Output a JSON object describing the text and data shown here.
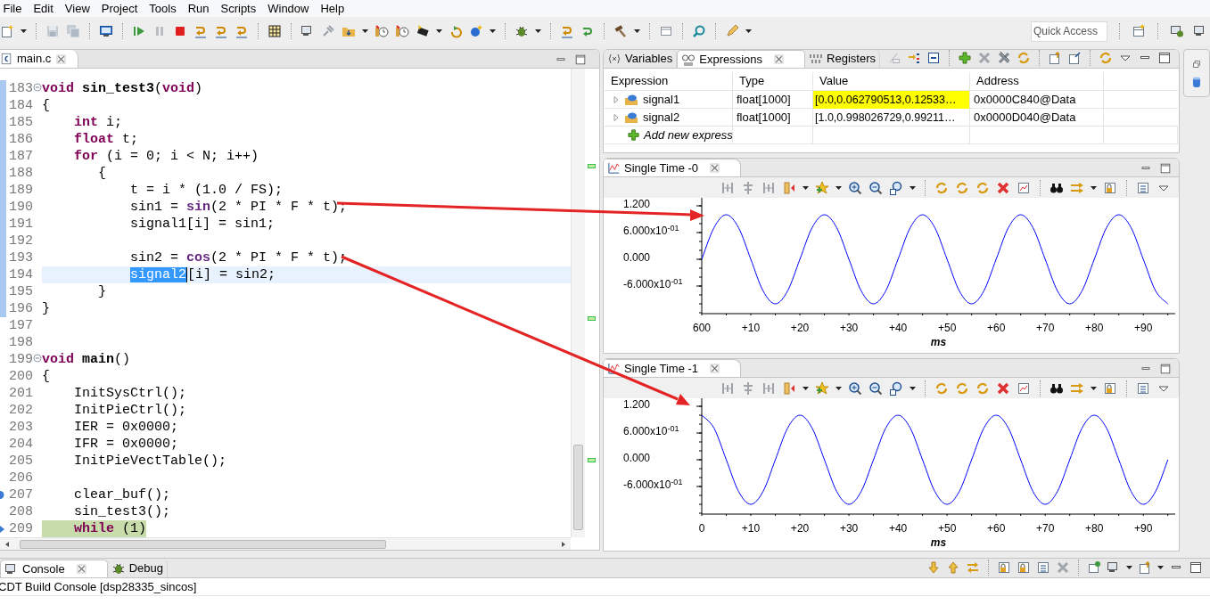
{
  "menu": [
    "File",
    "Edit",
    "View",
    "Project",
    "Tools",
    "Run",
    "Scripts",
    "Window",
    "Help"
  ],
  "quick_access": {
    "placeholder": "Quick Access"
  },
  "editor": {
    "tab": {
      "label": "main.c",
      "selected": true
    },
    "lines": [
      {
        "number": "183",
        "fold": true,
        "scope": true,
        "current": false,
        "executing": false,
        "breakpoint": false,
        "tokens": [
          {
            "text": "void",
            "kind": "keyword"
          },
          {
            "text": " sin_test3",
            "kind": "function"
          },
          {
            "text": "("
          },
          {
            "text": "void",
            "kind": "keyword"
          },
          {
            "text": ")"
          }
        ]
      },
      {
        "number": "184",
        "fold": false,
        "scope": true,
        "current": false,
        "executing": false,
        "breakpoint": false,
        "tokens": [
          {
            "text": "{"
          }
        ]
      },
      {
        "number": "185",
        "fold": false,
        "scope": true,
        "current": false,
        "executing": false,
        "breakpoint": false,
        "tokens": [
          {
            "text": "    int",
            "kind": "keyword"
          },
          {
            "text": " i;"
          }
        ]
      },
      {
        "number": "186",
        "fold": false,
        "scope": true,
        "current": false,
        "executing": false,
        "breakpoint": false,
        "tokens": [
          {
            "text": "    float",
            "kind": "keyword"
          },
          {
            "text": " t;"
          }
        ]
      },
      {
        "number": "187",
        "fold": false,
        "scope": true,
        "current": false,
        "executing": false,
        "breakpoint": false,
        "tokens": [
          {
            "text": "    for",
            "kind": "keyword"
          },
          {
            "text": " (i = 0; i < N; i++)"
          }
        ]
      },
      {
        "number": "188",
        "fold": false,
        "scope": true,
        "current": false,
        "executing": false,
        "breakpoint": false,
        "tokens": [
          {
            "text": "       {"
          }
        ]
      },
      {
        "number": "189",
        "fold": false,
        "scope": true,
        "current": false,
        "executing": false,
        "breakpoint": false,
        "tokens": [
          {
            "text": "           t = i * (1.0 / FS);"
          }
        ]
      },
      {
        "number": "190",
        "fold": false,
        "scope": true,
        "current": false,
        "executing": false,
        "breakpoint": false,
        "tokens": [
          {
            "text": "           sin1 = "
          },
          {
            "text": "sin",
            "kind": "builtin"
          },
          {
            "text": "(2 * PI * F * t);"
          }
        ]
      },
      {
        "number": "191",
        "fold": false,
        "scope": true,
        "current": false,
        "executing": false,
        "breakpoint": false,
        "tokens": [
          {
            "text": "           signal1[i] = sin1;"
          }
        ]
      },
      {
        "number": "192",
        "fold": false,
        "scope": true,
        "current": false,
        "executing": false,
        "breakpoint": false
      },
      {
        "number": "193",
        "fold": false,
        "scope": true,
        "current": false,
        "executing": false,
        "breakpoint": false,
        "tokens": [
          {
            "text": "           sin2 = "
          },
          {
            "text": "cos",
            "kind": "builtin"
          },
          {
            "text": "(2 * PI * F * t);"
          }
        ]
      },
      {
        "number": "194",
        "fold": false,
        "scope": true,
        "current": true,
        "executing": false,
        "breakpoint": false,
        "tokens": [
          {
            "text": "           signal2",
            "kind": "selection"
          },
          {
            "text": "[i] = sin2;"
          }
        ]
      },
      {
        "number": "195",
        "fold": false,
        "scope": true,
        "current": false,
        "executing": false,
        "breakpoint": false,
        "tokens": [
          {
            "text": "       }"
          }
        ]
      },
      {
        "number": "196",
        "fold": false,
        "scope": true,
        "current": false,
        "executing": false,
        "breakpoint": false,
        "tokens": [
          {
            "text": "}"
          }
        ]
      },
      {
        "number": "197",
        "fold": false,
        "scope": false,
        "current": false,
        "executing": false,
        "breakpoint": false
      },
      {
        "number": "198",
        "fold": false,
        "scope": false,
        "current": false,
        "executing": false,
        "breakpoint": false
      },
      {
        "number": "199",
        "fold": true,
        "scope": false,
        "current": false,
        "executing": false,
        "breakpoint": false,
        "tokens": [
          {
            "text": "void",
            "kind": "keyword"
          },
          {
            "text": " main",
            "kind": "function"
          },
          {
            "text": "()"
          }
        ]
      },
      {
        "number": "200",
        "fold": false,
        "scope": false,
        "current": false,
        "executing": false,
        "breakpoint": false,
        "tokens": [
          {
            "text": "{"
          }
        ]
      },
      {
        "number": "201",
        "fold": false,
        "scope": false,
        "current": false,
        "executing": false,
        "breakpoint": false,
        "tokens": [
          {
            "text": "    InitSysCtrl();"
          }
        ]
      },
      {
        "number": "202",
        "fold": false,
        "scope": false,
        "current": false,
        "executing": false,
        "breakpoint": false,
        "tokens": [
          {
            "text": "    InitPieCtrl();"
          }
        ]
      },
      {
        "number": "203",
        "fold": false,
        "scope": false,
        "current": false,
        "executing": false,
        "breakpoint": false,
        "tokens": [
          {
            "text": "    IER = 0x0000;"
          }
        ]
      },
      {
        "number": "204",
        "fold": false,
        "scope": false,
        "current": false,
        "executing": false,
        "breakpoint": false,
        "tokens": [
          {
            "text": "    IFR = 0x0000;"
          }
        ]
      },
      {
        "number": "205",
        "fold": false,
        "scope": false,
        "current": false,
        "executing": false,
        "breakpoint": false,
        "tokens": [
          {
            "text": "    InitPieVectTable();"
          }
        ]
      },
      {
        "number": "206",
        "fold": false,
        "scope": false,
        "current": false,
        "executing": false,
        "breakpoint": false
      },
      {
        "number": "207",
        "fold": false,
        "scope": false,
        "current": false,
        "executing": false,
        "breakpoint": true,
        "tokens": [
          {
            "text": "    clear_buf();"
          }
        ]
      },
      {
        "number": "208",
        "fold": false,
        "scope": false,
        "current": false,
        "executing": false,
        "breakpoint": false,
        "tokens": [
          {
            "text": "    sin_test3();"
          }
        ]
      },
      {
        "number": "209",
        "fold": false,
        "scope": false,
        "current": false,
        "executing": true,
        "breakpoint": false,
        "tokens": [
          {
            "text": "    while",
            "kind": "keyword"
          },
          {
            "text": " (1)"
          }
        ]
      }
    ]
  },
  "expressions": {
    "tabs": [
      {
        "label": "Variables",
        "kind": "variables",
        "selected": false
      },
      {
        "label": "Expressions",
        "kind": "expressions",
        "selected": true
      },
      {
        "label": "Registers",
        "kind": "registers",
        "selected": false
      }
    ],
    "columns": [
      "Expression",
      "Type",
      "Value",
      "Address"
    ],
    "rows": [
      {
        "expression": "signal1",
        "type": "float[1000]",
        "value": "[0.0,0.062790513,0.12533…",
        "address": "0x0000C840@Data",
        "expanded": false,
        "changed": true
      },
      {
        "expression": "signal2",
        "type": "float[1000]",
        "value": "[1.0,0.998026729,0.99211…",
        "address": "0x0000D040@Data",
        "expanded": false,
        "changed": false
      }
    ],
    "add_row": "Add new express"
  },
  "graphs": [
    {
      "tab": "Single Time -0",
      "chart_data": {
        "type": "line",
        "xlabel": "ms",
        "categories": [
          "600",
          null,
          null,
          null,
          "+10",
          null,
          null,
          null,
          "+20",
          null,
          null,
          null,
          "+30",
          null,
          null,
          null,
          "+40",
          null,
          null,
          null,
          "+50",
          null,
          null,
          null,
          "+60",
          null,
          null,
          null,
          "+70",
          null,
          null,
          null,
          "+80",
          null,
          null,
          null,
          "+90",
          null,
          null
        ],
        "series": [
          {
            "color": "#0000ff",
            "values": [
              0,
              0.71,
              1,
              0.71,
              0,
              -0.71,
              -1,
              -0.71,
              0,
              0.71,
              1,
              0.71,
              0,
              -0.71,
              -1,
              -0.71,
              0,
              0.71,
              1,
              0.71,
              0,
              -0.71,
              -1,
              -0.71,
              0,
              0.71,
              1,
              0.71,
              0,
              -0.71,
              -1,
              -0.71,
              0,
              0.71,
              1,
              0.71,
              0,
              -0.71,
              -1
            ]
          }
        ],
        "ylim": [
          -1.22,
          1.38
        ],
        "yticks": [
          {
            "value": 1.2,
            "label": "1.200"
          },
          {
            "value": 0.6,
            "label": "6.000x10$^{-01}$"
          },
          {
            "value": 0,
            "label": "0.000"
          },
          {
            "value": -0.6,
            "label": "-6.000x10$^{-01}$"
          }
        ]
      }
    },
    {
      "tab": "Single Time -1",
      "chart_data": {
        "type": "line",
        "xlabel": "ms",
        "x": [
          0,
          2.5,
          5,
          7.5,
          10,
          12.5,
          15,
          17.5,
          20,
          22.5,
          25,
          27.5,
          30,
          32.5,
          35,
          37.5,
          40,
          42.5,
          45,
          47.5,
          50,
          52.5,
          55,
          57.5,
          60,
          62.5,
          65,
          67.5,
          70,
          72.5,
          75,
          77.5,
          80,
          82.5,
          85,
          87.5,
          90,
          92.5,
          95
        ],
        "series": [
          {
            "color": "#0000ff",
            "values": [
              1,
              0.71,
              0,
              -0.71,
              -1,
              -0.71,
              0,
              0.71,
              1,
              0.71,
              0,
              -0.71,
              -1,
              -0.71,
              0,
              0.71,
              1,
              0.71,
              0,
              -0.71,
              -1,
              -0.71,
              0,
              0.71,
              1,
              0.71,
              0,
              -0.71,
              -1,
              -0.71,
              0,
              0.71,
              1,
              0.71,
              0,
              -0.71,
              -1,
              -0.71,
              0
            ]
          }
        ],
        "xlim": [
          0,
          96.5
        ],
        "ylim": [
          -1.22,
          1.38
        ],
        "xticks": [
          {
            "value": 0,
            "label": "0"
          },
          {
            "value": 10,
            "label": "+10"
          },
          {
            "value": 20,
            "label": "+20"
          },
          {
            "value": 30,
            "label": "+30"
          },
          {
            "value": 40,
            "label": "+40"
          },
          {
            "value": 50,
            "label": "+50"
          },
          {
            "value": 60,
            "label": "+60"
          },
          {
            "value": 70,
            "label": "+70"
          },
          {
            "value": 80,
            "label": "+80"
          },
          {
            "value": 90,
            "label": "+90"
          }
        ],
        "yticks": [
          {
            "value": 1.2,
            "label": "1.200"
          },
          {
            "value": 0.6,
            "label": "6.000x10$^{-01}$"
          },
          {
            "value": 0,
            "label": "0.000"
          },
          {
            "value": -0.6,
            "label": "-6.000x10$^{-01}$"
          }
        ]
      }
    }
  ],
  "console": {
    "tabs": [
      {
        "label": "Console",
        "kind": "console",
        "selected": true
      },
      {
        "label": "Debug",
        "kind": "debug",
        "selected": false
      }
    ],
    "title": "CDT Build Console [dsp28335_sincos]"
  }
}
